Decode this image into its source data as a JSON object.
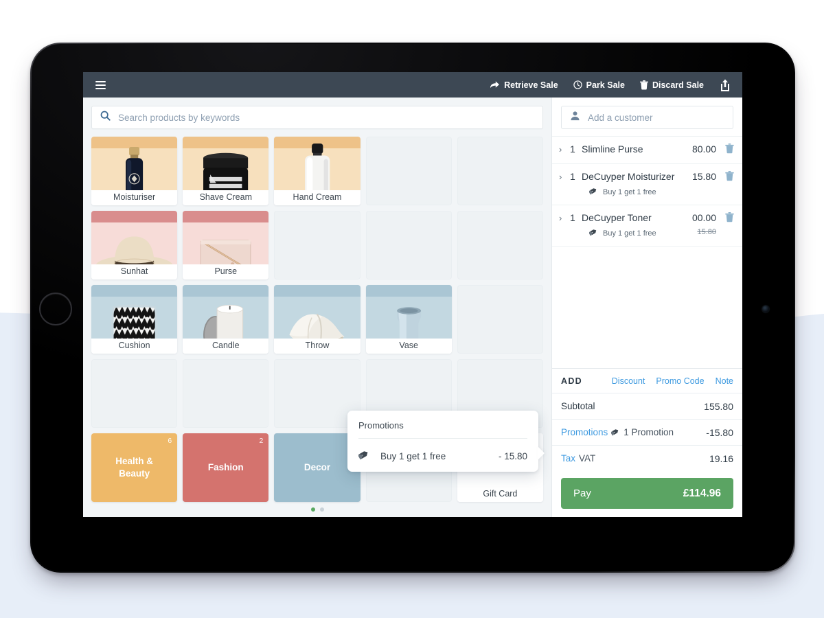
{
  "topbar": {
    "menu_icon": "hamburger-icon",
    "actions": [
      {
        "label": "Retrieve Sale",
        "icon": "arrow-return-icon"
      },
      {
        "label": "Park Sale",
        "icon": "clock-icon"
      },
      {
        "label": "Discard Sale",
        "icon": "trash-icon"
      }
    ],
    "share_icon": "share-upload-icon"
  },
  "search": {
    "placeholder": "Search products by keywords",
    "value": "",
    "icon": "search-icon"
  },
  "catalog": {
    "tiles": [
      {
        "name": "Moisturiser",
        "band": "#eec288",
        "bg": "#f7e0bd",
        "art": "bottle-dark",
        "empty": false
      },
      {
        "name": "Shave Cream",
        "band": "#eec288",
        "bg": "#f7e0bd",
        "art": "jar-black",
        "empty": false
      },
      {
        "name": "Hand Cream",
        "band": "#eec288",
        "bg": "#f7e0bd",
        "art": "tube-white",
        "empty": false
      },
      {
        "name": "",
        "empty": true
      },
      {
        "name": "",
        "empty": true
      },
      {
        "name": "Sunhat",
        "band": "#d98d8d",
        "bg": "#f7dcd8",
        "art": "sunhat",
        "empty": false
      },
      {
        "name": "Purse",
        "band": "#d98d8d",
        "bg": "#f7dcd8",
        "art": "purse",
        "empty": false
      },
      {
        "name": "",
        "empty": true
      },
      {
        "name": "",
        "empty": true
      },
      {
        "name": "",
        "empty": true
      },
      {
        "name": "Cushion",
        "band": "#aac6d4",
        "bg": "#c3d8e1",
        "art": "cushion",
        "empty": false
      },
      {
        "name": "Candle",
        "band": "#aac6d4",
        "bg": "#c3d8e1",
        "art": "candle",
        "empty": false
      },
      {
        "name": "Throw",
        "band": "#aac6d4",
        "bg": "#c3d8e1",
        "art": "throw",
        "empty": false
      },
      {
        "name": "Vase",
        "band": "#aac6d4",
        "bg": "#c3d8e1",
        "art": "vase",
        "empty": false
      },
      {
        "name": "",
        "empty": true
      },
      {
        "name": "",
        "empty": true
      },
      {
        "name": "",
        "empty": true
      },
      {
        "name": "",
        "empty": true
      },
      {
        "name": "",
        "empty": true
      },
      {
        "name": "",
        "empty": true
      }
    ],
    "categories": [
      {
        "label": "Health & Beauty",
        "count": "6",
        "color": "#eeb969"
      },
      {
        "label": "Fashion",
        "count": "2",
        "color": "#d4736e"
      },
      {
        "label": "Decor",
        "count": "",
        "color": "#9cbdcd"
      },
      {
        "label": "",
        "count": "",
        "color": ""
      },
      {
        "label": "Gift Card",
        "count": "",
        "color": "#5fa95f"
      }
    ],
    "pages": [
      {
        "active": true
      },
      {
        "active": false
      }
    ]
  },
  "promotions_popover": {
    "title": "Promotions",
    "icon": "tag-icon",
    "item_label": "Buy 1 get 1 free",
    "item_value": "- 15.80"
  },
  "cart": {
    "customer": {
      "placeholder": "Add a customer",
      "icon": "person-icon"
    },
    "items": [
      {
        "qty": "1",
        "name": "Slimline Purse",
        "price": "80.00",
        "promo": "",
        "price_was": "",
        "chevron": "›",
        "delete_icon": "trash-icon"
      },
      {
        "qty": "1",
        "name": "DeCuyper Moisturizer",
        "price": "15.80",
        "promo": "Buy 1 get 1 free",
        "price_was": "",
        "chevron": "›",
        "delete_icon": "trash-icon"
      },
      {
        "qty": "1",
        "name": "DeCuyper Toner",
        "price": "00.00",
        "promo": "Buy 1 get 1 free",
        "price_was": "15.80",
        "chevron": "›",
        "delete_icon": "trash-icon"
      }
    ],
    "add_row": {
      "label": "ADD",
      "links": [
        "Discount",
        "Promo Code",
        "Note"
      ]
    },
    "totals": [
      {
        "label": "Subtotal",
        "sub": "",
        "value": "155.80",
        "label_link": false,
        "has_tag_icon": false
      },
      {
        "label": "Promotions",
        "sub": "1 Promotion",
        "value": "-15.80",
        "label_link": true,
        "has_tag_icon": true
      },
      {
        "label": "Tax",
        "sub": "VAT",
        "value": "19.16",
        "label_link": true,
        "has_tag_icon": false
      }
    ],
    "pay": {
      "label": "Pay",
      "amount": "£114.96",
      "color": "#5ba463"
    }
  }
}
